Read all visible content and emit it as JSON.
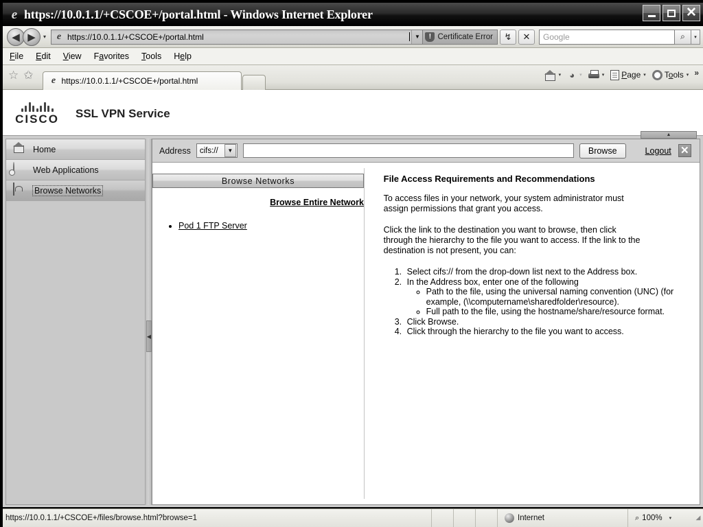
{
  "browser": {
    "title": "https://10.0.1.1/+CSCOE+/portal.html - Windows Internet Explorer",
    "window_controls": {
      "minimize": "_",
      "maximize": "□",
      "close": "✕"
    },
    "address": {
      "url": "https://10.0.1.1/+CSCOE+/portal.html",
      "dropdown_caret": "▼",
      "certificate_error": "Certificate Error",
      "refresh_icon": "↯",
      "stop_icon": "✕"
    },
    "search": {
      "placeholder": "Google",
      "go_icon": "⌕",
      "dropdown_caret": "▾"
    },
    "menu": [
      {
        "pre": "",
        "accel": "F",
        "post": "ile"
      },
      {
        "pre": "",
        "accel": "E",
        "post": "dit"
      },
      {
        "pre": "",
        "accel": "V",
        "post": "iew"
      },
      {
        "pre": "F",
        "accel": "a",
        "post": "vorites"
      },
      {
        "pre": "",
        "accel": "T",
        "post": "ools"
      },
      {
        "pre": "H",
        "accel": "e",
        "post": "lp"
      }
    ],
    "tab": {
      "label": "https://10.0.1.1/+CSCOE+/portal.html"
    },
    "toolbar": {
      "home_caret": "▾",
      "feed_caret": "▾",
      "print_caret": "▾",
      "page_label": "Page",
      "page_accel": "P",
      "page_caret": "▾",
      "tools_label": "Tools",
      "tools_accel": "o",
      "tools_caret": "▾",
      "overflow": "»"
    },
    "statusbar": {
      "url": "https://10.0.1.1/+CSCOE+/files/browse.html?browse=1",
      "zone": "Internet",
      "zoom": "100%",
      "zoom_caret": "▾"
    }
  },
  "portal": {
    "brand": {
      "wordmark": "CISCO",
      "service_title": "SSL VPN Service"
    },
    "sidebar": [
      {
        "label": "Home",
        "icon": "home-icon",
        "selected": false
      },
      {
        "label": "Web Applications",
        "icon": "web-applications-icon",
        "selected": false
      },
      {
        "label": "Browse Networks",
        "icon": "browse-networks-icon",
        "selected": true
      }
    ],
    "toolbar": {
      "address_label": "Address",
      "protocol_value": "cifs://",
      "protocol_caret": "▼",
      "address_value": "",
      "browse_label": "Browse",
      "logout_label": "Logout",
      "close_label": "✕"
    },
    "collapse_up_icon": "▲",
    "splitter_icon": "◀",
    "left_pane": {
      "heading_button": "Browse Networks",
      "entire_network_link": "Browse Entire Network",
      "servers": [
        "Pod 1 FTP Server"
      ]
    },
    "right_pane": {
      "title": "File Access Requirements and Recommendations",
      "paragraph_1": "To access files in your network, your system administrator must assign permissions that grant you access.",
      "paragraph_2": "Click the link to the destination you want to browse, then click through the hierarchy to the file you want to access. If the link to the destination is not present, you can:",
      "steps": [
        "Select cifs:// from the drop-down list next to the Address box.",
        "In the Address box, enter one of the following",
        "Click Browse.",
        "Click through the hierarchy to the file you want to access."
      ],
      "sub_steps": [
        "Path to the file, using the universal naming convention (UNC) (for example, (\\\\computername\\sharedfolder\\resource).",
        "Full path to the file, using the hostname/share/resource format."
      ]
    }
  }
}
